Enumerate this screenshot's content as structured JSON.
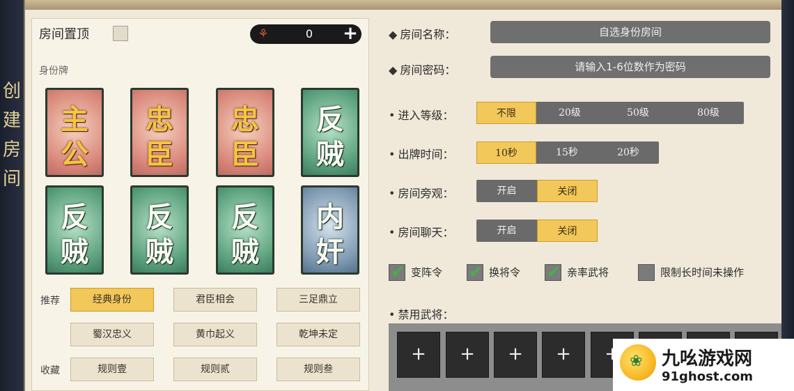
{
  "sidebar": {
    "text": "创建房间"
  },
  "room": {
    "top_label": "房间置顶",
    "coin_value": "0",
    "plus": "+",
    "coin_icon": "⚘"
  },
  "roles": {
    "label": "身份牌",
    "cards": [
      {
        "t1": "主",
        "t2": "公",
        "style": "pink"
      },
      {
        "t1": "忠",
        "t2": "臣",
        "style": "pink"
      },
      {
        "t1": "忠",
        "t2": "臣",
        "style": "pink"
      },
      {
        "t1": "反",
        "t2": "贼",
        "style": "green"
      },
      {
        "t1": "反",
        "t2": "贼",
        "style": "green"
      },
      {
        "t1": "反",
        "t2": "贼",
        "style": "green"
      },
      {
        "t1": "反",
        "t2": "贼",
        "style": "green"
      },
      {
        "t1": "内",
        "t2": "奸",
        "style": "blue"
      }
    ]
  },
  "modes": {
    "recommend_label": "推荐",
    "collect_label": "收藏",
    "recommend": [
      "经典身份",
      "君臣相会",
      "三足鼎立",
      "蜀汉忠义",
      "黄巾起义",
      "乾坤未定"
    ],
    "collect": [
      "规则壹",
      "规则贰",
      "规则叁"
    ]
  },
  "form": {
    "name_label": "房间名称：",
    "name_value": "自选身份房间",
    "password_label": "房间密码：",
    "password_placeholder": "请输入1-6位数作为密码",
    "level_label": "进入等级：",
    "level_options": [
      "不限",
      "20级",
      "50级",
      "80级"
    ],
    "time_label": "出牌时间：",
    "time_options": [
      "10秒",
      "15秒",
      "20秒"
    ],
    "watch_label": "房间旁观：",
    "watch_options": [
      "开启",
      "关闭"
    ],
    "chat_label": "房间聊天：",
    "chat_options": [
      "开启",
      "关闭"
    ],
    "checks": [
      {
        "label": "变阵令",
        "checked": true
      },
      {
        "label": "换将令",
        "checked": true
      },
      {
        "label": "亲率武将",
        "checked": true
      },
      {
        "label": "限制长时间未操作",
        "checked": false
      }
    ],
    "ban_label": "禁用武将：",
    "ban_slot": "+"
  },
  "watermark": {
    "title": "九吆游戏网",
    "url": "91ghost.com"
  }
}
